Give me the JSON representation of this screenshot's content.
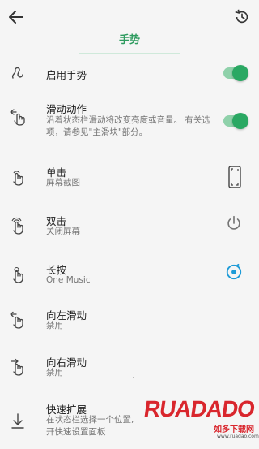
{
  "header": {
    "title": "手势"
  },
  "gestures": [
    {
      "title": "启用手势",
      "sub": "",
      "toggle": true
    },
    {
      "title": "滑动动作",
      "desc": "沿着状态栏滑动将改变亮度或音量。 有关选项，请参见\"主滑块\"部分。",
      "toggle": true
    },
    {
      "title": "单击",
      "sub": "屏幕截图",
      "action_icon": "phone-screenshot-icon"
    },
    {
      "title": "双击",
      "sub": "关闭屏幕",
      "action_icon": "power-icon"
    },
    {
      "title": "长按",
      "sub": "One Music",
      "action_icon": "music-app-icon"
    },
    {
      "title": "向左滑动",
      "sub": "禁用"
    },
    {
      "title": "向右滑动",
      "sub": "禁用"
    },
    {
      "title": "快速扩展",
      "desc": "在状态栏选择一个位置, 开快速设置面板"
    }
  ],
  "colors": {
    "accent": "#2e9b5f",
    "toggle_knob": "#2aa863",
    "toggle_track": "#8fd1aa",
    "power_action": "#757575",
    "music_action": "#1e9bd7"
  },
  "watermark": {
    "letters": "RUADADO",
    "cn": "如多下载网",
    "url": "www.ruadao.com"
  }
}
